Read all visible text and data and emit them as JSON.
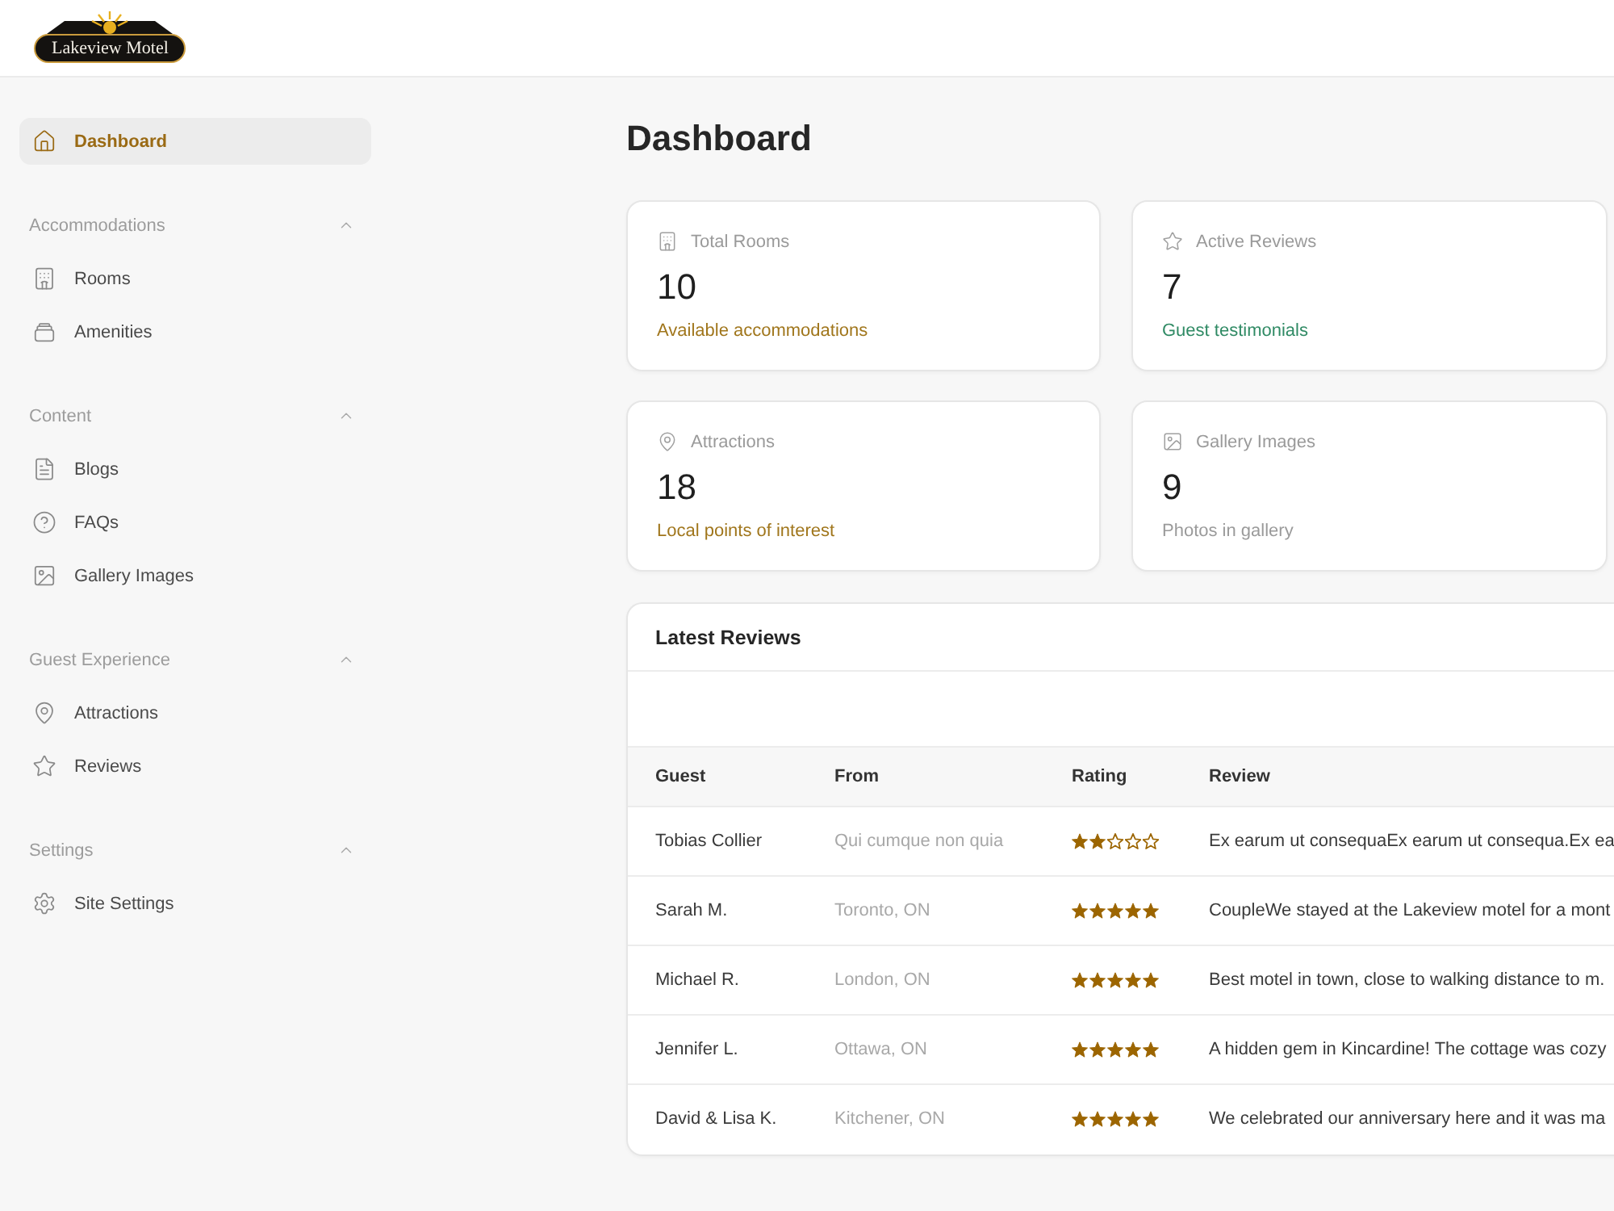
{
  "header": {
    "logo_text": "Lakeview Motel"
  },
  "sidebar": {
    "items": [
      {
        "label": "Dashboard",
        "selected": true
      }
    ],
    "sections": [
      {
        "title": "Accommodations",
        "expanded": true,
        "items": [
          {
            "label": "Rooms",
            "selected": false
          },
          {
            "label": "Amenities",
            "selected": false
          }
        ]
      },
      {
        "title": "Content",
        "expanded": true,
        "items": [
          {
            "label": "Blogs",
            "selected": false
          },
          {
            "label": "FAQs",
            "selected": false
          },
          {
            "label": "Gallery Images",
            "selected": false
          }
        ]
      },
      {
        "title": "Guest Experience",
        "expanded": true,
        "items": [
          {
            "label": "Attractions",
            "selected": false
          },
          {
            "label": "Reviews",
            "selected": false
          }
        ]
      },
      {
        "title": "Settings",
        "expanded": true,
        "items": [
          {
            "label": "Site Settings",
            "selected": false
          }
        ]
      }
    ]
  },
  "main": {
    "title": "Dashboard",
    "stats": [
      {
        "label": "Total Rooms",
        "value": "10",
        "note": "Available accommodations",
        "color": "#a0761c"
      },
      {
        "label": "Active Reviews",
        "value": "7",
        "note": "Guest testimonials",
        "color": "#2f8a64"
      },
      {
        "label": "Attractions",
        "value": "18",
        "note": "Local points of interest",
        "color": "#a0761c"
      },
      {
        "label": "Gallery Images",
        "value": "9",
        "note": "Photos in gallery",
        "color": "#9a9a9a"
      }
    ],
    "reviews": {
      "title": "Latest Reviews",
      "columns": [
        "Guest",
        "From",
        "Rating",
        "Review"
      ],
      "rows": [
        {
          "guest": "Tobias Collier",
          "from": "Qui cumque non quia",
          "stars": 2,
          "review": "Ex earum ut consequaEx earum ut consequa.Ex ea"
        },
        {
          "guest": "Sarah M.",
          "from": "Toronto, ON",
          "stars": 5,
          "review": "CoupleWe stayed at the Lakeview motel for a mont"
        },
        {
          "guest": "Michael R.",
          "from": "London, ON",
          "stars": 5,
          "review": "Best motel in town, close to walking distance to m."
        },
        {
          "guest": "Jennifer L.",
          "from": "Ottawa, ON",
          "stars": 5,
          "review": "A hidden gem in Kincardine! The cottage was cozy"
        },
        {
          "guest": "David & Lisa K.",
          "from": "Kitchener, ON",
          "stars": 5,
          "review": "We celebrated our anniversary here and it was ma"
        }
      ]
    }
  }
}
